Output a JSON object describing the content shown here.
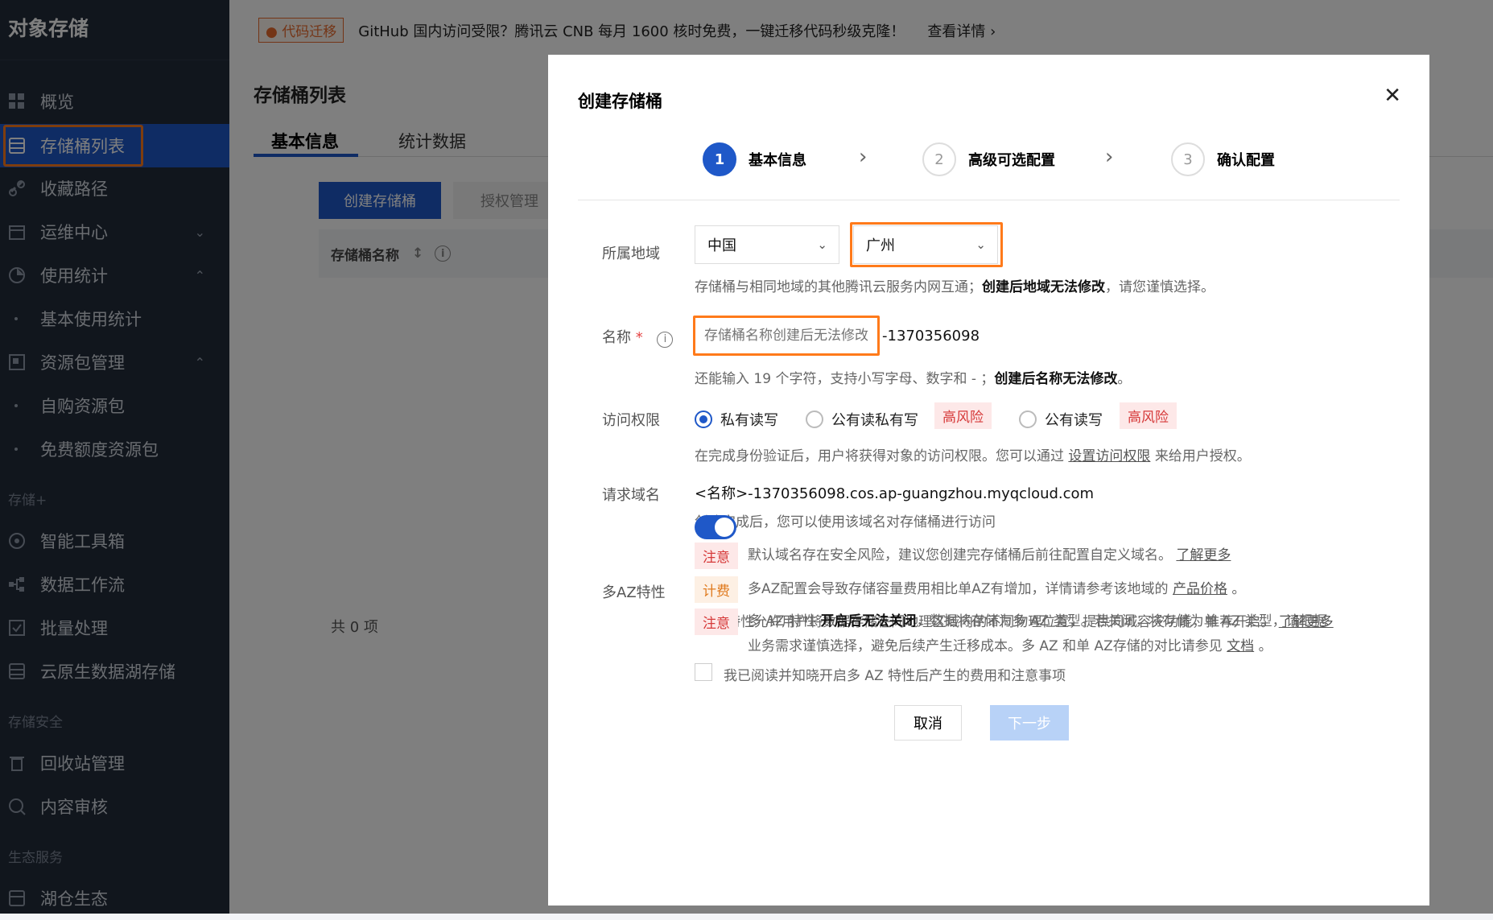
{
  "sidebar": {
    "title": "对象存储",
    "items": [
      {
        "label": "概览"
      },
      {
        "label": "存储桶列表"
      },
      {
        "label": "收藏路径"
      },
      {
        "label": "运维中心"
      },
      {
        "label": "使用统计"
      },
      {
        "label": "基本使用统计"
      },
      {
        "label": "资源包管理"
      },
      {
        "label": "自购资源包"
      },
      {
        "label": "免费额度资源包"
      },
      {
        "label": "智能工具箱"
      },
      {
        "label": "数据工作流"
      },
      {
        "label": "批量处理"
      },
      {
        "label": "云原生数据湖存储"
      },
      {
        "label": "回收站管理"
      },
      {
        "label": "内容审核"
      },
      {
        "label": "湖仓生态"
      }
    ],
    "groups": [
      "存储+",
      "存储安全",
      "生态服务"
    ]
  },
  "banner": {
    "tag": "代码迁移",
    "message": "GitHub 国内访问受限？腾讯云 CNB 每月 1600 核时免费，一键迁移代码秒级克隆！",
    "more": "查看详情"
  },
  "main": {
    "title": "存储桶列表",
    "tabs": [
      "基本信息",
      "统计数据"
    ],
    "create_button": "创建存储桶",
    "auth_button": "授权管理",
    "column_name": "存储桶名称",
    "total": "共 0 项"
  },
  "modal": {
    "title": "创建存储桶",
    "steps": [
      {
        "num": "1",
        "label": "基本信息"
      },
      {
        "num": "2",
        "label": "高级可选配置"
      },
      {
        "num": "3",
        "label": "确认配置"
      }
    ],
    "region": {
      "label": "所属地域",
      "country": "中国",
      "city": "广州",
      "hint_prefix": "存储桶与相同地域的其他腾讯云服务内网互通；",
      "hint_bold": "创建后地域无法修改",
      "hint_suffix": "，请您谨慎选择。"
    },
    "name": {
      "label": "名称",
      "required": "*",
      "placeholder": "存储桶名称创建后无法修改",
      "suffix": "-1370356098",
      "hint_prefix": "还能输入 19 个字符，支持小写字母、数字和 - ；",
      "hint_bold": "创建后名称无法修改",
      "hint_suffix": "。"
    },
    "access": {
      "label": "访问权限",
      "options": [
        "私有读写",
        "公有读私有写",
        "公有读写"
      ],
      "selected": "私有读写",
      "risk": "高风险",
      "hint_prefix": "在完成身份验证后，用户将获得对象的访问权限。您可以通过",
      "hint_link": "设置访问权限",
      "hint_suffix": "来给用户授权。"
    },
    "domain": {
      "label": "请求域名",
      "value": "<名称>-1370356098.cos.ap-guangzhou.myqcloud.com",
      "hint": "创建完成后，您可以使用该域名对存储桶进行访问",
      "notice_badge": "注意",
      "notice": "默认域名存在安全风险，建议您创建完存储桶后前往配置自定义域名。",
      "notice_link": "了解更多"
    },
    "multi_az": {
      "label": "多AZ特性",
      "enabled": true,
      "hint": "多AZ特性允许用户将数据存储在同地理区域内的不同物理位置，提供同城容灾功能，推荐开启。",
      "hint_link": "了解更多",
      "billing_badge": "计费",
      "billing_text": "多AZ配置会导致存储容量费用相比单AZ有增加，详情请参考该地域的",
      "billing_link": "产品价格",
      "billing_suffix": "。",
      "notice_badge": "注意",
      "notice_prefix": "多 AZ 特性",
      "notice_bold": "开启后无法关闭",
      "notice_suffix": "，数据将存储为多 AZ 类型。若关闭，将存储为单 AZ 类型，请根据",
      "notice_line2": "业务需求谨慎选择，避免后续产生迁移成本。多 AZ 和单 AZ存储的对比请参见",
      "notice_link": "文档",
      "notice_end": "。",
      "agreement": "我已阅读并知晓开启多 AZ 特性后产生的费用和注意事项"
    },
    "buttons": {
      "cancel": "取消",
      "next": "下一步"
    }
  }
}
